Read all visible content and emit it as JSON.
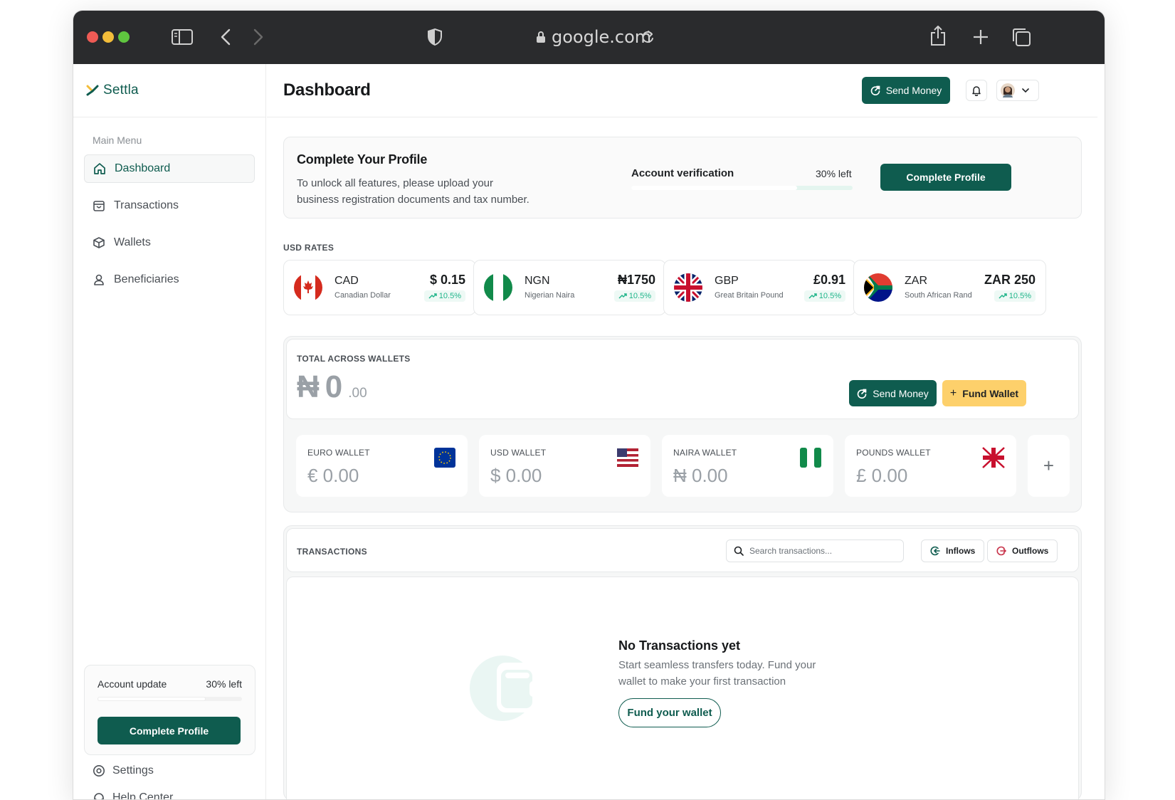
{
  "browser": {
    "url": "google.com"
  },
  "app": {
    "brand": "Settla"
  },
  "sidebar": {
    "caption": "Main Menu",
    "items": [
      {
        "label": "Dashboard",
        "icon": "home-icon"
      },
      {
        "label": "Transactions",
        "icon": "calendar-icon"
      },
      {
        "label": "Wallets",
        "icon": "cube-icon"
      },
      {
        "label": "Beneficiaries",
        "icon": "user-icon"
      }
    ],
    "account_update": {
      "label": "Account update",
      "left": "30% left",
      "progress": 0.75,
      "button": "Complete Profile"
    },
    "settings": "Settings",
    "help": "Help Center"
  },
  "header": {
    "title": "Dashboard",
    "send_money": "Send Money"
  },
  "profile": {
    "title": "Complete Your Profile",
    "description_line1": "To unlock all features, please upload your",
    "description_line2": "business registration documents and tax number.",
    "verification_label": "Account verification",
    "verification_left": "30% left",
    "progress": 0.75,
    "button": "Complete Profile"
  },
  "rates": {
    "caption": "USD RATES",
    "items": [
      {
        "code": "CAD",
        "name": "Canadian Dollar",
        "value": "$ 0.15",
        "change": "10.5%",
        "flag": "canada-flag-icon"
      },
      {
        "code": "NGN",
        "name": "Nigerian Naira",
        "value": "₦1750",
        "change": "10.5%",
        "flag": "nigeria-flag-icon"
      },
      {
        "code": "GBP",
        "name": "Great Britain Pound",
        "value": "£0.91",
        "change": "10.5%",
        "flag": "uk-flag-icon"
      },
      {
        "code": "ZAR",
        "name": "South African Rand",
        "value": "ZAR 250",
        "change": "10.5%",
        "flag": "south-africa-flag-icon"
      }
    ]
  },
  "total": {
    "caption": "TOTAL ACROSS WALLETS",
    "currency": "₦",
    "whole": "0",
    "decimals": ".00",
    "send_money": "Send Money",
    "fund_wallet": "Fund Wallet"
  },
  "wallets": [
    {
      "label": "EURO WALLET",
      "amount": "€ 0.00",
      "flag": "eu-flag-icon"
    },
    {
      "label": "USD WALLET",
      "amount": "$ 0.00",
      "flag": "us-flag-icon"
    },
    {
      "label": "NAIRA WALLET",
      "amount": "₦ 0.00",
      "flag": "nigeria-flag-icon"
    },
    {
      "label": "POUNDS WALLET",
      "amount": "£ 0.00",
      "flag": "uk-flag-icon"
    }
  ],
  "transactions": {
    "caption": "TRANSACTIONS",
    "search_placeholder": "Search transactions...",
    "inflows": "Inflows",
    "outflows": "Outflows",
    "empty_title": "No Transactions yet",
    "empty_line1": "Start seamless transfers today. Fund your",
    "empty_line2": "wallet to make your first transaction",
    "empty_button": "Fund your wallet"
  },
  "colors": {
    "primary": "#0f5c4f",
    "accent": "#fdd06b",
    "positive": "#1fb58a",
    "progress": "#e4f5ef"
  }
}
